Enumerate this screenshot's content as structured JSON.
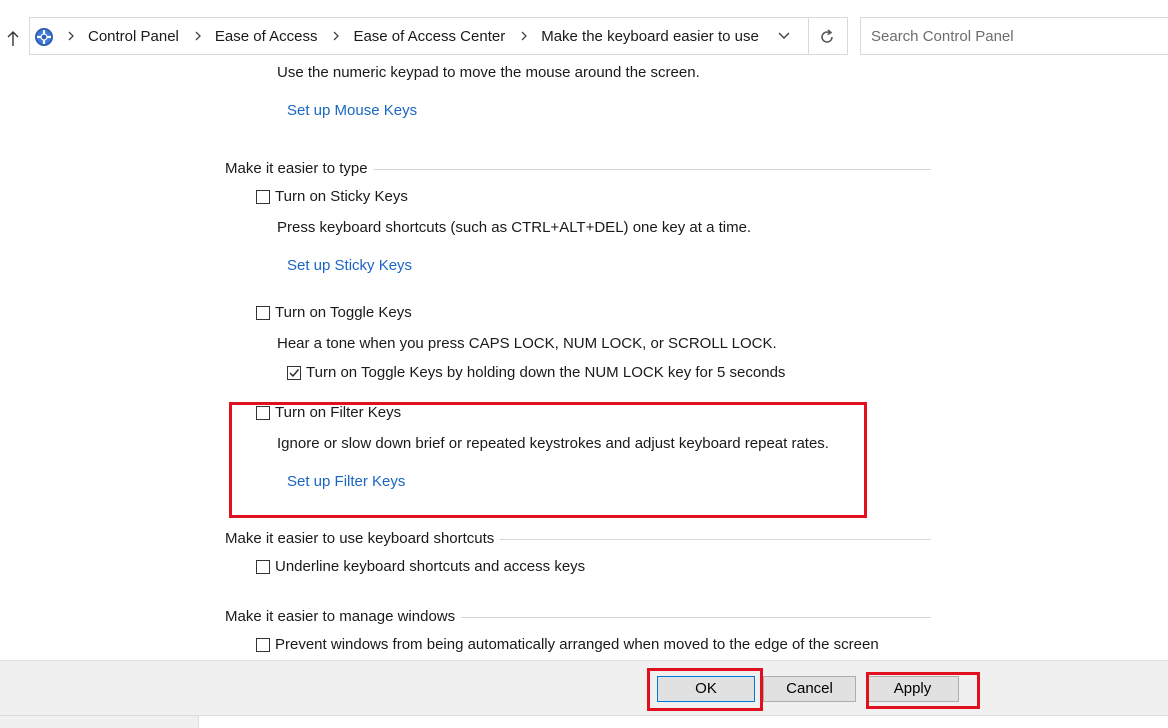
{
  "address_bar": {
    "breadcrumbs": [
      "Control Panel",
      "Ease of Access",
      "Ease of Access Center",
      "Make the keyboard easier to use"
    ],
    "search_placeholder": "Search Control Panel"
  },
  "mouse_keys": {
    "description": "Use the numeric keypad to move the mouse around the screen.",
    "setup_link": "Set up Mouse Keys"
  },
  "typing_section": {
    "heading": "Make it easier to type",
    "sticky_keys": {
      "checkbox_label": "Turn on Sticky Keys",
      "checked": false,
      "description": "Press keyboard shortcuts (such as CTRL+ALT+DEL) one key at a time.",
      "setup_link": "Set up Sticky Keys"
    },
    "toggle_keys": {
      "checkbox_label": "Turn on Toggle Keys",
      "checked": false,
      "description": "Hear a tone when you press CAPS LOCK, NUM LOCK, or SCROLL LOCK.",
      "sub_checkbox_label": "Turn on Toggle Keys by holding down the NUM LOCK key for 5 seconds",
      "sub_checked": true
    },
    "filter_keys": {
      "checkbox_label": "Turn on Filter Keys",
      "checked": false,
      "description": "Ignore or slow down brief or repeated keystrokes and adjust keyboard repeat rates.",
      "setup_link": "Set up Filter Keys"
    }
  },
  "shortcuts_section": {
    "heading": "Make it easier to use keyboard shortcuts",
    "underline_label": "Underline keyboard shortcuts and access keys",
    "underline_checked": false
  },
  "windows_section": {
    "heading": "Make it easier to manage windows",
    "prevent_label": "Prevent windows from being automatically arranged when moved to the edge of the screen",
    "prevent_checked": false
  },
  "footer": {
    "ok_label": "OK",
    "cancel_label": "Cancel",
    "apply_label": "Apply"
  },
  "colors": {
    "link": "#1a66c4",
    "highlight": "#e0101e"
  }
}
